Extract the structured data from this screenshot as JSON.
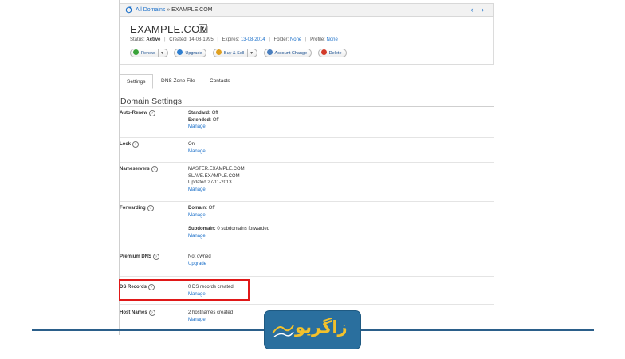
{
  "breadcrumb": {
    "root": "All Domains",
    "separator": "»",
    "current": "EXAMPLE.COM",
    "nav": "‹ ›"
  },
  "header": {
    "domain": "EXAMPLE.COM",
    "status_label": "Status:",
    "status_value": "Active",
    "created_label": "Created:",
    "created_value": "14-08-1995",
    "expires_label": "Expires:",
    "expires_value": "13-08-2014",
    "folder_label": "Folder:",
    "folder_value": "None",
    "profile_label": "Profile:",
    "profile_value": "None",
    "buttons": {
      "renew": "Renew",
      "upgrade": "Upgrade",
      "buy_sell": "Buy & Sell",
      "account_change": "Account Change",
      "delete": "Delete"
    }
  },
  "tabs": [
    "Settings",
    "DNS Zone File",
    "Contacts"
  ],
  "section_title": "Domain Settings",
  "settings": {
    "auto_renew": {
      "label": "Auto-Renew",
      "line1": "Standard:",
      "line1_val": "Off",
      "line2": "Extended:",
      "line2_val": "Off",
      "link": "Manage"
    },
    "lock": {
      "label": "Lock",
      "value": "On",
      "link": "Manage"
    },
    "nameservers": {
      "label": "Nameservers",
      "ns1": "MASTER.EXAMPLE.COM",
      "ns2": "SLAVE.EXAMPLE.COM",
      "updated": "Updated 27-11-2013",
      "link": "Manage"
    },
    "forwarding": {
      "label": "Forwarding",
      "domain_label": "Domain:",
      "domain_val": "Off",
      "link1": "Manage",
      "sub_label": "Subdomain:",
      "sub_val": "0 subdomains forwarded",
      "link2": "Manage"
    },
    "premium_dns": {
      "label": "Premium DNS",
      "value": "Not owned",
      "link": "Upgrade"
    },
    "ds_records": {
      "label": "DS Records",
      "value": "0 DS records created",
      "link": "Manage"
    },
    "host_names": {
      "label": "Host Names",
      "value": "2 hostnames created",
      "link": "Manage"
    }
  },
  "logo": {
    "text": "زاگریو"
  },
  "colors": {
    "link": "#1a6fc9",
    "highlight": "#e01818",
    "logo_bg": "#2a6f9e",
    "logo_text": "#f3c12b",
    "bottom_line": "#2b5f8a"
  }
}
